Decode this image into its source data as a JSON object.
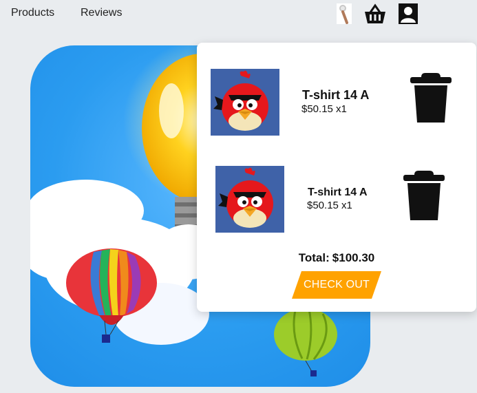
{
  "nav": {
    "links": [
      "Products",
      "Reviews"
    ],
    "icons": [
      "search-icon",
      "basket-icon",
      "user-icon"
    ]
  },
  "hero": {
    "image": "hot-air-balloons-and-lightbulb-illustration",
    "colors": {
      "sky": "#2b9cf0",
      "bulb": "#ffd21f",
      "balloon_primary": "#e8343a",
      "balloon_secondary": "#9ccc2a"
    }
  },
  "cart": {
    "items": [
      {
        "title": "T-shirt 14 A",
        "price": "$50.15 x1",
        "thumbnail": "red-angry-bird",
        "remove_icon": "trash-icon"
      },
      {
        "title": "T-shirt 14 A",
        "price": "$50.15 x1",
        "thumbnail": "red-angry-bird",
        "remove_icon": "trash-icon"
      }
    ],
    "total_label": "Total:",
    "total_value": "$100.30",
    "checkout_label": "CHECK OUT",
    "checkout_color": "#ffa200"
  }
}
